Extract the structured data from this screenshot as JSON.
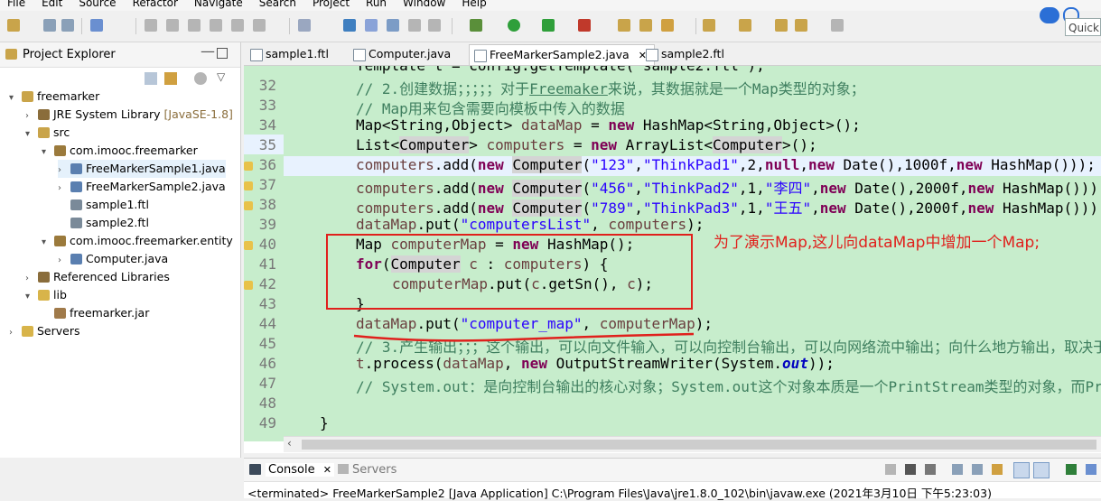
{
  "menu": [
    "File",
    "Edit",
    "Source",
    "Refactor",
    "Navigate",
    "Search",
    "Project",
    "Run",
    "Window",
    "Help"
  ],
  "quick_access": "Quick",
  "project_explorer": {
    "title": "Project Explorer",
    "items": [
      {
        "label": "freemarker",
        "depth": 0,
        "arrow": "▾",
        "icon": "project-icon"
      },
      {
        "label": "JRE System Library",
        "suffix": "[JavaSE-1.8]",
        "depth": 1,
        "arrow": "›",
        "icon": "library-icon"
      },
      {
        "label": "src",
        "depth": 1,
        "arrow": "▾",
        "icon": "source-folder-icon"
      },
      {
        "label": "com.imooc.freemarker",
        "depth": 2,
        "arrow": "▾",
        "icon": "package-icon"
      },
      {
        "label": "FreeMarkerSample1.java",
        "depth": 3,
        "arrow": "›",
        "icon": "java-file-icon",
        "selected": true
      },
      {
        "label": "FreeMarkerSample2.java",
        "depth": 3,
        "arrow": "›",
        "icon": "java-file-icon"
      },
      {
        "label": "sample1.ftl",
        "depth": 3,
        "arrow": "",
        "icon": "ftl-file-icon"
      },
      {
        "label": "sample2.ftl",
        "depth": 3,
        "arrow": "",
        "icon": "ftl-file-icon"
      },
      {
        "label": "com.imooc.freemarker.entity",
        "depth": 2,
        "arrow": "▾",
        "icon": "package-icon"
      },
      {
        "label": "Computer.java",
        "depth": 3,
        "arrow": "›",
        "icon": "java-file-icon"
      },
      {
        "label": "Referenced Libraries",
        "depth": 1,
        "arrow": "›",
        "icon": "library-icon"
      },
      {
        "label": "lib",
        "depth": 1,
        "arrow": "▾",
        "icon": "folder-icon"
      },
      {
        "label": "freemarker.jar",
        "depth": 2,
        "arrow": "",
        "icon": "jar-icon"
      },
      {
        "label": "Servers",
        "depth": 0,
        "arrow": "›",
        "icon": "folder-icon"
      }
    ]
  },
  "editor": {
    "tabs": [
      {
        "label": "sample1.ftl",
        "active": false
      },
      {
        "label": "Computer.java",
        "active": false
      },
      {
        "label": "FreeMarkerSample2.java",
        "active": true,
        "close": "✕"
      },
      {
        "label": "sample2.ftl",
        "active": false
      }
    ],
    "line_numbers": [
      "32",
      "33",
      "34",
      "35",
      "36",
      "37",
      "38",
      "39",
      "40",
      "41",
      "42",
      "43",
      "44",
      "45",
      "46",
      "47",
      "48",
      "49"
    ],
    "warning_lines": [
      "36",
      "37",
      "38",
      "40",
      "42"
    ],
    "highlight_line": "35"
  },
  "console": {
    "tabs": [
      "Console",
      "Servers"
    ],
    "text": "<terminated> FreeMarkerSample2 [Java Application] C:\\Program Files\\Java\\jre1.8.0_102\\bin\\javaw.exe (2021年3月10日 下午5:23:03)"
  },
  "annotation": {
    "text": "为了演示Map,这儿向dataMap中增加一个Map;",
    "color": "#e0201c"
  },
  "colors": {
    "editor_bg": "#c7edcc",
    "keyword": "#7f0055",
    "string": "#2a00ff",
    "comment": "#3f7f5f"
  }
}
